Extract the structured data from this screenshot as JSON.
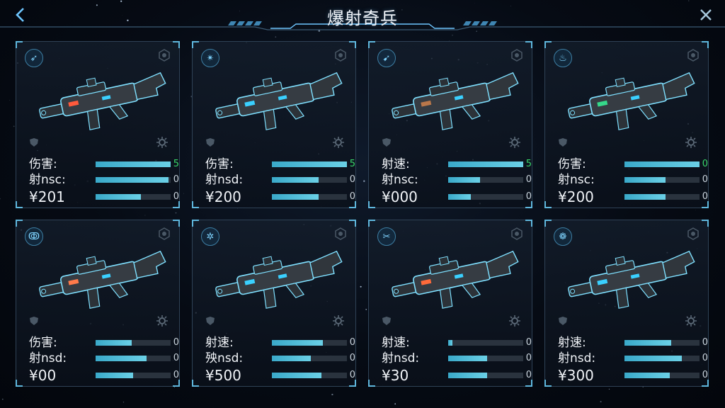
{
  "title": "爆射奇兵",
  "header": {
    "back_icon": "chevron-left-icon",
    "close_icon": "close-icon",
    "accent": "#6ec6ff"
  },
  "colors": {
    "bar_fill": "#4fbfdc",
    "bar_track": "#2a333e",
    "card_border": "#2f4256",
    "value_green": "#39d66a"
  },
  "weapons": [
    {
      "badge_icon": "arrow-icon",
      "stats": [
        {
          "label": "伤害:",
          "value": "5",
          "fill": 1.0,
          "green": true
        },
        {
          "label": "射nsc:",
          "value": "0",
          "fill": 0.97,
          "green": false
        },
        {
          "label": "¥201",
          "value": "0",
          "fill": 0.6,
          "green": false
        }
      ]
    },
    {
      "badge_icon": "star-icon",
      "stats": [
        {
          "label": "伤害:",
          "value": "5",
          "fill": 1.0,
          "green": true
        },
        {
          "label": "射nsd:",
          "value": "0",
          "fill": 0.62,
          "green": false
        },
        {
          "label": "¥200",
          "value": "0",
          "fill": 0.62,
          "green": false
        }
      ]
    },
    {
      "badge_icon": "plane-icon",
      "stats": [
        {
          "label": "射速:",
          "value": "5",
          "fill": 1.0,
          "green": true
        },
        {
          "label": "射nsc:",
          "value": "0",
          "fill": 0.42,
          "green": false
        },
        {
          "label": "¥000",
          "value": "0",
          "fill": 0.3,
          "green": false
        }
      ]
    },
    {
      "badge_icon": "flame-icon",
      "stats": [
        {
          "label": "伤害:",
          "value": "0",
          "fill": 1.0,
          "green": true
        },
        {
          "label": "射nsc:",
          "value": "0",
          "fill": 0.55,
          "green": false
        },
        {
          "label": "¥200",
          "value": "0",
          "fill": 0.55,
          "green": false
        }
      ]
    },
    {
      "badge_icon": "ring-icon",
      "stats": [
        {
          "label": "伤害:",
          "value": "0",
          "fill": 0.48,
          "green": false
        },
        {
          "label": "射nsd:",
          "value": "0",
          "fill": 0.68,
          "green": false
        },
        {
          "label": "¥00",
          "value": "0",
          "fill": 0.5,
          "green": false
        }
      ]
    },
    {
      "badge_icon": "spark-icon",
      "stats": [
        {
          "label": "射速:",
          "value": "0",
          "fill": 0.68,
          "green": false
        },
        {
          "label": "殃nsd:",
          "value": "0",
          "fill": 0.52,
          "green": false
        },
        {
          "label": "¥500",
          "value": "0",
          "fill": 0.66,
          "green": false
        }
      ]
    },
    {
      "badge_icon": "scissors-icon",
      "stats": [
        {
          "label": "射速:",
          "value": "0",
          "fill": 0.06,
          "green": false
        },
        {
          "label": "射nsd:",
          "value": "0",
          "fill": 0.52,
          "green": false
        },
        {
          "label": "¥30",
          "value": "0",
          "fill": 0.52,
          "green": false
        }
      ]
    },
    {
      "badge_icon": "wing-icon",
      "stats": [
        {
          "label": "射速:",
          "value": "0",
          "fill": 0.62,
          "green": false
        },
        {
          "label": "射nsd:",
          "value": "0",
          "fill": 0.76,
          "green": false
        },
        {
          "label": "¥300",
          "value": "0",
          "fill": 0.6,
          "green": false
        }
      ]
    }
  ]
}
